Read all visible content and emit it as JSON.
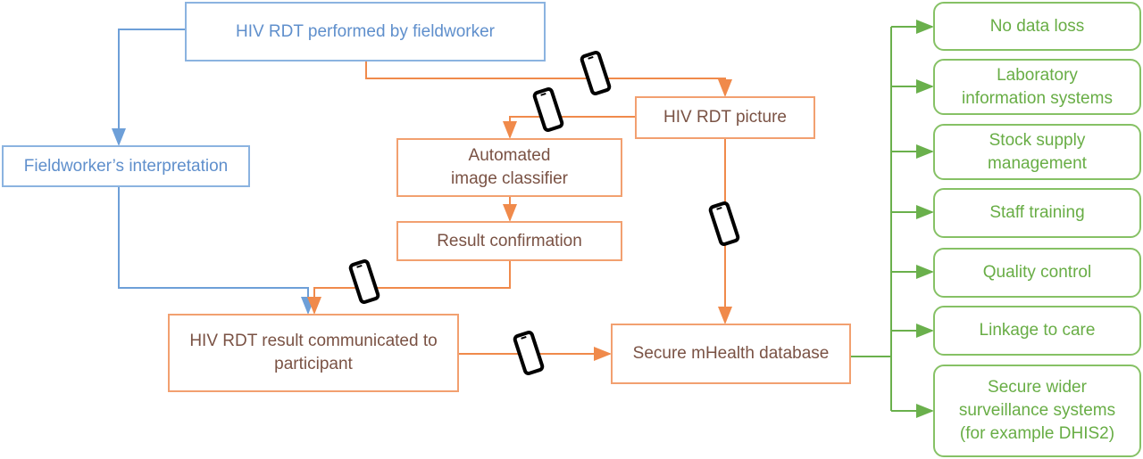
{
  "colors": {
    "blue": "#6d9fd8",
    "orange": "#f08a4b",
    "green": "#6ab04c"
  },
  "nodes": {
    "rdt_performed": "HIV RDT performed by fieldworker",
    "fieldworker_interpretation": "Fieldworker’s interpretation",
    "rdt_picture": "HIV RDT picture",
    "image_classifier": "Automated\nimage classifier",
    "result_confirmation": "Result confirmation",
    "result_communicated": "HIV RDT result communicated to\nparticipant",
    "mhealth_database": "Secure mHealth database"
  },
  "outcomes": [
    "No data loss",
    "Laboratory\ninformation systems",
    "Stock supply\nmanagement",
    "Staff training",
    "Quality control",
    "Linkage to care",
    "Secure wider\nsurveillance systems\n(for example DHIS2)"
  ],
  "icons": [
    "smartphone-icon"
  ]
}
